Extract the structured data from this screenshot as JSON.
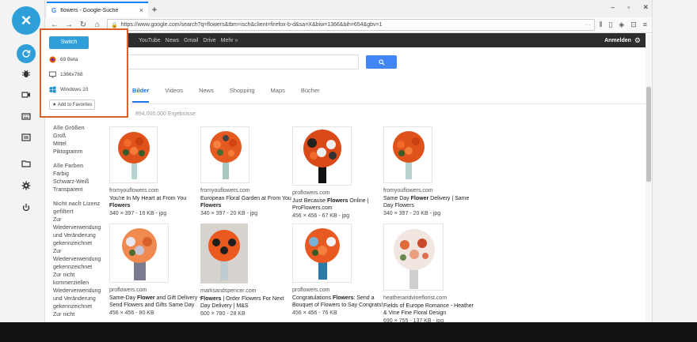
{
  "tool_rail": {
    "close_icon": "×",
    "buttons": [
      "refresh-icon",
      "bug-icon",
      "video-icon",
      "keyboard-icon",
      "folder-icon",
      "gear-icon",
      "power-icon"
    ]
  },
  "browser": {
    "tab_title": "flowers - Google-Suche",
    "tab_close": "×",
    "new_tab": "+",
    "window_controls": [
      "–",
      "▫",
      "✕"
    ],
    "url": "https://www.google.com/search?q=flowers&tbm=isch&client=firefox-b-d&sa=X&biw=1366&bih=654&gbv=1",
    "url_menu": "···",
    "google_bar": {
      "links": [
        "YouTube",
        "News",
        "Gmail",
        "Drive",
        "Mehr »"
      ],
      "signin": "Anmelden"
    },
    "tabs": [
      "Bilder",
      "Videos",
      "News",
      "Shopping",
      "Maps",
      "Bücher"
    ],
    "results_count": "894.000.000 Ergebnisse"
  },
  "filters": {
    "size_head": "Alle Größen",
    "size": [
      "Groß",
      "Mittel",
      "Piktogramm"
    ],
    "color_head": "Alle Farben",
    "color": [
      "Farbig",
      "Schwarz-Weiß",
      "Transparent"
    ],
    "license_head": "Nicht nach Lizenz gefiltert",
    "license": [
      "Zur Wiederverwendung und Veränderung gekennzeichnet",
      "Zur Wiederverwendung gekennzeichnet",
      "Zur nicht kommerziellen Wiederverwendung und Veränderung gekennzeichnet",
      "Zur nicht"
    ]
  },
  "results": [
    {
      "source": "fromyouflowers.com",
      "title_pre": "You're In My Heart at From You ",
      "title_bold": "Flowers",
      "title_post": "",
      "size": "340 × 397 - 16 KB - jpg"
    },
    {
      "source": "fromyouflowers.com",
      "title_pre": "European Floral Garden at From You ",
      "title_bold": "Flowers",
      "title_post": "",
      "size": "340 × 397 - 20 KB - jpg"
    },
    {
      "source": "proflowers.com",
      "title_pre": "Just Because ",
      "title_bold": "Flowers",
      "title_post": " Online | ProFlowers.com",
      "size": "456 × 456 - 67 KB - jpg"
    },
    {
      "source": "fromyouflowers.com",
      "title_pre": "Same Day ",
      "title_bold": "Flower",
      "title_post": " Delivery | Same Day Flowers",
      "size": "340 × 397 - 20 KB - jpg"
    },
    {
      "source": "proflowers.com",
      "title_pre": "Same-Day ",
      "title_bold": "Flower",
      "title_post": " and Gift Delivery - Send Flowers and Gifts Same Day",
      "size": "456 × 456 - 80 KB"
    },
    {
      "source": "marksandspencer.com",
      "title_pre": "",
      "title_bold": "Flowers",
      "title_post": " | Order Flowers For Next Day Delivery | M&S",
      "size": "600 × 780 - 28 KB"
    },
    {
      "source": "proflowers.com",
      "title_pre": "Congratulations ",
      "title_bold": "Flowers",
      "title_post": ": Send a Bouquet of Flowers to Say Congrats!",
      "size": "456 × 456 - 76 KB"
    },
    {
      "source": "heatherandvineflorist.com",
      "title_pre": "Fields of Europe Romance - Heather & Vine Fine Floral Design",
      "title_bold": "",
      "title_post": "",
      "size": "690 × 755 - 137 KB - jpg"
    }
  ],
  "popup": {
    "switch_label": "Switch",
    "browser": "69 Beta",
    "resolution": "1366x768",
    "os": "Windows 10",
    "favorites": "Add to Favorites"
  },
  "colors": {
    "accent": "#2e9fd8",
    "popup_border": "#d9622b",
    "google_blue": "#4285f4"
  }
}
